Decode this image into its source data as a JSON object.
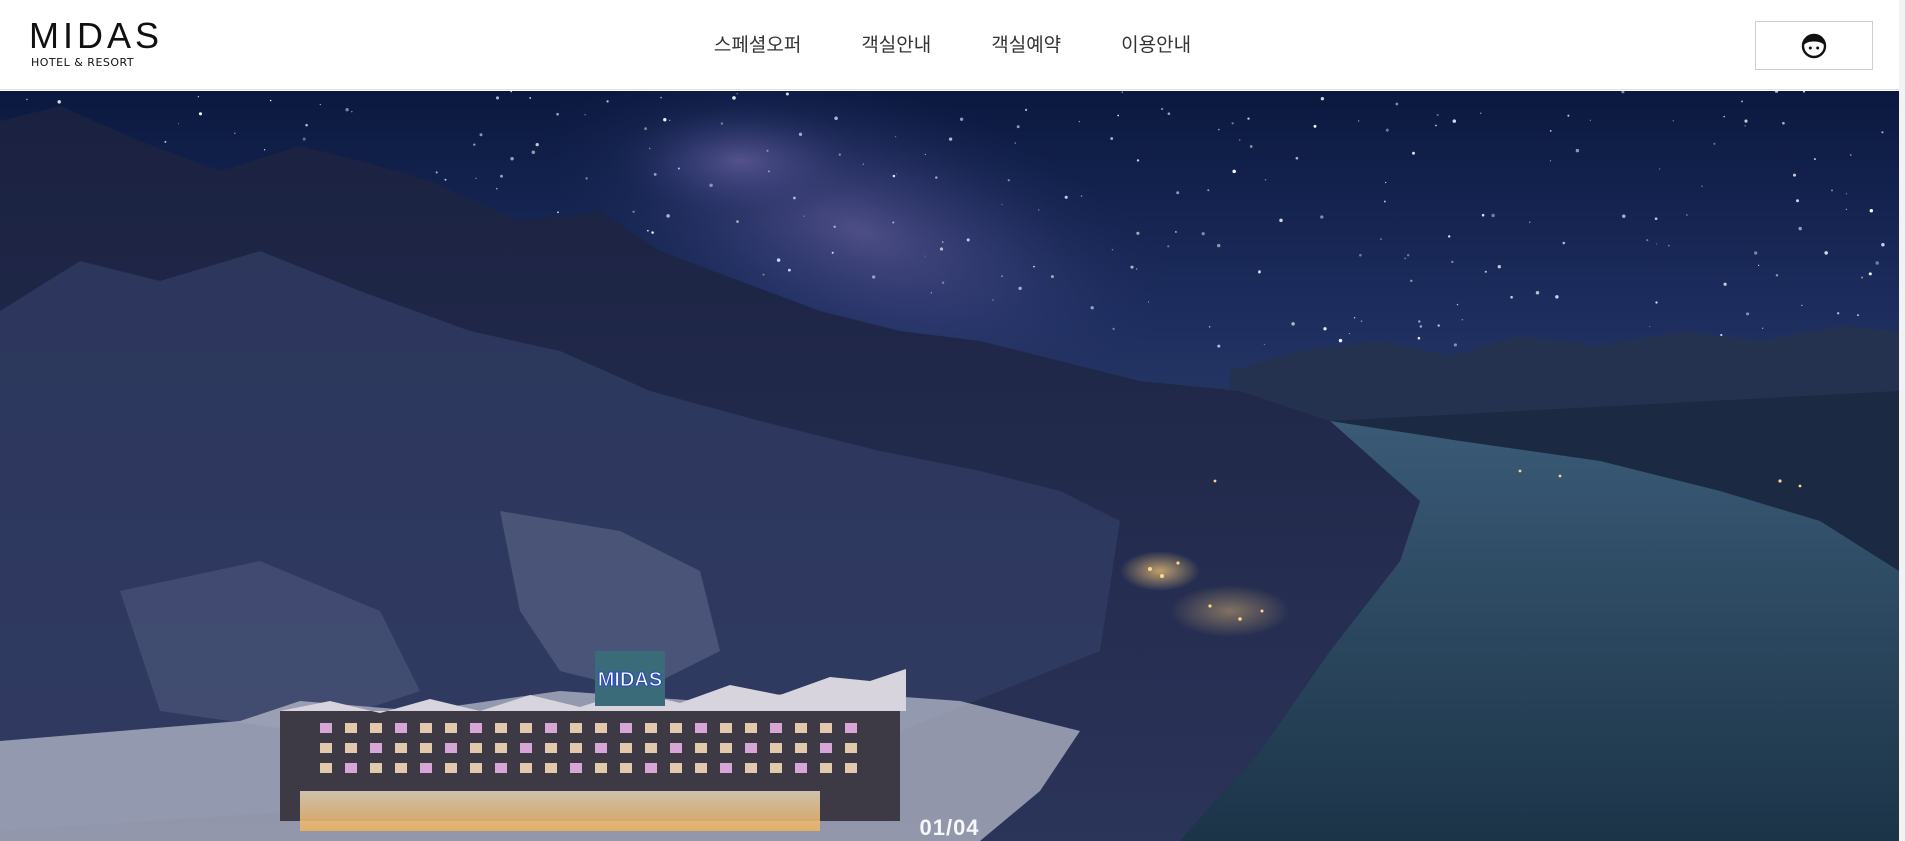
{
  "header": {
    "logo": {
      "name": "MIDAS",
      "sub": "HOTEL & RESORT"
    },
    "nav": [
      {
        "label": "스페셜오퍼"
      },
      {
        "label": "객실안내"
      },
      {
        "label": "객실예약"
      },
      {
        "label": "이용안내"
      }
    ],
    "user_icon": "user-face-icon"
  },
  "hero": {
    "image_alt": "Aerial night view of MIDAS hotel & resort under a starry sky by the river",
    "building_sign": "MIDAS",
    "slide_current": "01",
    "slide_total": "04",
    "slide_separator": "/"
  },
  "colors": {
    "header_bg": "#ffffff",
    "nav_text": "#333333",
    "sky_top": "#0b1940",
    "sign_blue": "#2a45c9"
  }
}
